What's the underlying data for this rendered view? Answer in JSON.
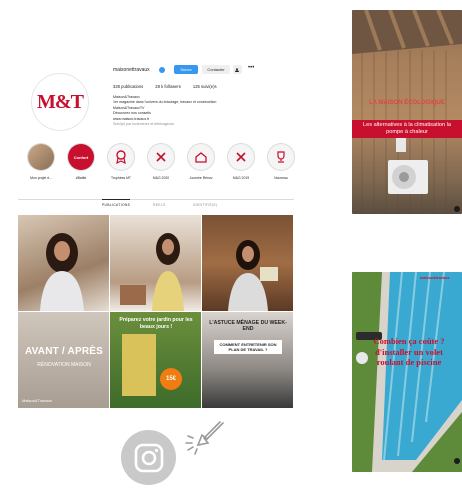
{
  "profile": {
    "username": "maisonettravaux",
    "follow_label": "Suivre",
    "contact_label": "Contacter",
    "avatar_text": "M&T",
    "stats": {
      "posts": "328 publications",
      "followers": "28 k followers",
      "following": "125 suivi(e)s"
    },
    "bio": {
      "name": "Maison&Travaux",
      "line1": "1er magazine dans l'univers du bricolage, travaux et construction",
      "line2": "Maison&TravauxTV",
      "line3": "Découvrez nos conseils",
      "link": "www.maison-travaux.fr",
      "followed_by": "Suivi(e) par lucienchez et lebricageurs"
    }
  },
  "highlights": [
    {
      "label": "Mon projet d...",
      "icon": "photo"
    },
    {
      "label": "#Battle",
      "icon": "Confort"
    },
    {
      "label": "Trophées MT",
      "icon": "medal-icon"
    },
    {
      "label": "M&G 2020",
      "icon": "tools-icon"
    },
    {
      "label": "Journée Rénov",
      "icon": "house-icon"
    },
    {
      "label": "M&G 2019",
      "icon": "tools-icon"
    },
    {
      "label": "Nouveau",
      "icon": "trophy-icon"
    }
  ],
  "tabs": {
    "publications": "PUBLICATIONS",
    "reels": "REELS",
    "identifie": "IDENTIFIÉ(E)"
  },
  "grid": {
    "post4_title": "AVANT / APRÈS",
    "post4_sub": "RÉNOVATION MAISON",
    "post4_brand": "Maison&Travaux",
    "post5_title": "Préparez votre jardin pour les beaux jours !",
    "post5_price": "15€",
    "post6_title": "L'ASTUCE MÉNAGE DU WEEK-END",
    "post6_sub": "COMMENT ENTRETENIR SON PLAN DE TRAVAIL ?"
  },
  "card1": {
    "brand": "LA MAISON ÉCOLOGIQUE",
    "title": "Les alternatives à la climatisation la pompe à chaleur"
  },
  "card2": {
    "brand": "maison&travaux",
    "title": "Combien ça coûte ? d'installer un volet roulant de piscine"
  },
  "colors": {
    "brand_red": "#c8102e",
    "follow_blue": "#3897f0"
  }
}
